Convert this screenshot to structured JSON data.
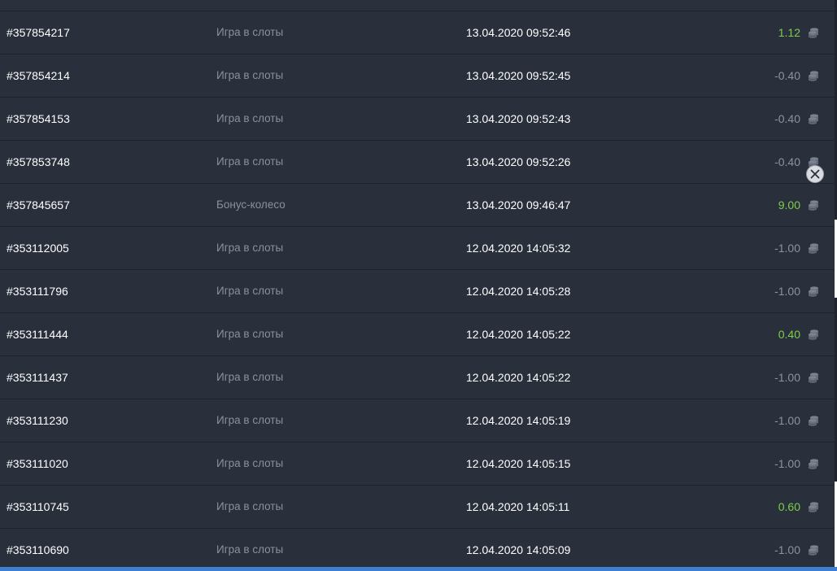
{
  "transactions": [
    {
      "id": "#357854217",
      "type": "Игра в слоты",
      "datetime": "13.04.2020 09:52:46",
      "amount": "1.12",
      "positive": true
    },
    {
      "id": "#357854214",
      "type": "Игра в слоты",
      "datetime": "13.04.2020 09:52:45",
      "amount": "-0.40",
      "positive": false
    },
    {
      "id": "#357854153",
      "type": "Игра в слоты",
      "datetime": "13.04.2020 09:52:43",
      "amount": "-0.40",
      "positive": false
    },
    {
      "id": "#357853748",
      "type": "Игра в слоты",
      "datetime": "13.04.2020 09:52:26",
      "amount": "-0.40",
      "positive": false
    },
    {
      "id": "#357845657",
      "type": "Бонус-колесо",
      "datetime": "13.04.2020 09:46:47",
      "amount": "9.00",
      "positive": true
    },
    {
      "id": "#353112005",
      "type": "Игра в слоты",
      "datetime": "12.04.2020 14:05:32",
      "amount": "-1.00",
      "positive": false
    },
    {
      "id": "#353111796",
      "type": "Игра в слоты",
      "datetime": "12.04.2020 14:05:28",
      "amount": "-1.00",
      "positive": false
    },
    {
      "id": "#353111444",
      "type": "Игра в слоты",
      "datetime": "12.04.2020 14:05:22",
      "amount": "0.40",
      "positive": true
    },
    {
      "id": "#353111437",
      "type": "Игра в слоты",
      "datetime": "12.04.2020 14:05:22",
      "amount": "-1.00",
      "positive": false
    },
    {
      "id": "#353111230",
      "type": "Игра в слоты",
      "datetime": "12.04.2020 14:05:19",
      "amount": "-1.00",
      "positive": false
    },
    {
      "id": "#353111020",
      "type": "Игра в слоты",
      "datetime": "12.04.2020 14:05:15",
      "amount": "-1.00",
      "positive": false
    },
    {
      "id": "#353110745",
      "type": "Игра в слоты",
      "datetime": "12.04.2020 14:05:11",
      "amount": "0.60",
      "positive": true
    },
    {
      "id": "#353110690",
      "type": "Игра в слоты",
      "datetime": "12.04.2020 14:05:09",
      "amount": "-1.00",
      "positive": false
    }
  ],
  "icons": {
    "currency": "coins-stack-icon",
    "close": "close-icon"
  },
  "colors": {
    "positive": "#7ccf49",
    "negative": "#8d929e",
    "background": "#2a2f3c",
    "accent": "#3d7fd1"
  }
}
